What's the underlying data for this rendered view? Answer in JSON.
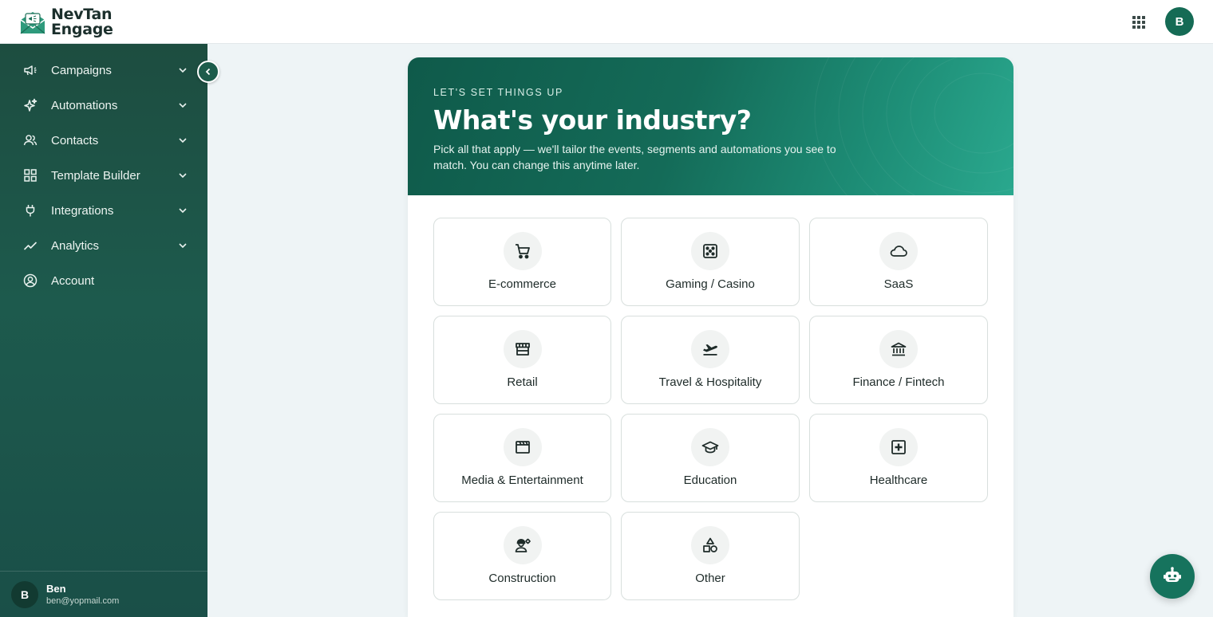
{
  "app": {
    "logo_line1": "NevTan",
    "logo_line2": "Engage",
    "user_initial": "B"
  },
  "sidebar": {
    "items": [
      {
        "label": "Campaigns",
        "icon": "megaphone-icon",
        "has_chevron": true
      },
      {
        "label": "Automations",
        "icon": "sparkles-icon",
        "has_chevron": true
      },
      {
        "label": "Contacts",
        "icon": "users-icon",
        "has_chevron": true
      },
      {
        "label": "Template Builder",
        "icon": "grid-icon",
        "has_chevron": true
      },
      {
        "label": "Integrations",
        "icon": "plug-icon",
        "has_chevron": true
      },
      {
        "label": "Analytics",
        "icon": "trend-icon",
        "has_chevron": true
      },
      {
        "label": "Account",
        "icon": "user-circle-icon",
        "has_chevron": false
      }
    ],
    "user": {
      "initial": "B",
      "name": "Ben",
      "email": "ben@yopmail.com"
    }
  },
  "onboarding": {
    "eyebrow": "LET'S SET THINGS UP",
    "title": "What's your industry?",
    "subtitle": "Pick all that apply — we'll tailor the events, segments and automations you see to match. You can change this anytime later.",
    "industries": [
      {
        "label": "E-commerce",
        "icon": "cart-icon"
      },
      {
        "label": "Gaming / Casino",
        "icon": "dice-icon"
      },
      {
        "label": "SaaS",
        "icon": "cloud-icon"
      },
      {
        "label": "Retail",
        "icon": "store-icon"
      },
      {
        "label": "Travel & Hospitality",
        "icon": "plane-icon"
      },
      {
        "label": "Finance / Fintech",
        "icon": "bank-icon"
      },
      {
        "label": "Media & Entertainment",
        "icon": "clapperboard-icon"
      },
      {
        "label": "Education",
        "icon": "graduation-cap-icon"
      },
      {
        "label": "Healthcare",
        "icon": "medical-cross-icon"
      },
      {
        "label": "Construction",
        "icon": "worker-icon"
      },
      {
        "label": "Other",
        "icon": "shapes-icon"
      }
    ]
  },
  "colors": {
    "sidebar": "#1d5a4d",
    "accent": "#16735d",
    "hero_start": "#0f5a4a",
    "hero_end": "#2aa88e"
  }
}
